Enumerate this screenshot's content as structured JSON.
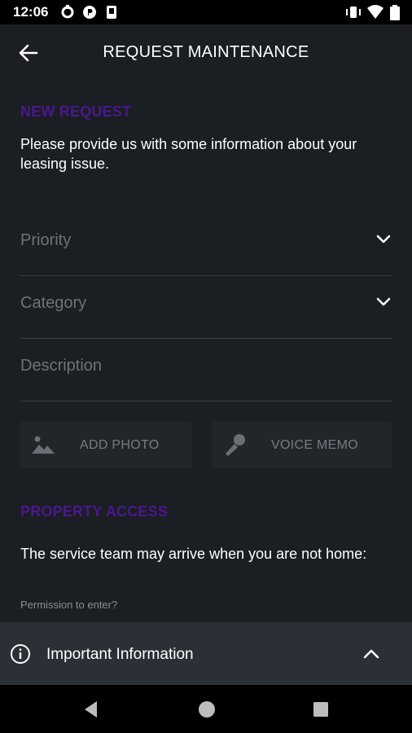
{
  "status_bar": {
    "time": "12:06"
  },
  "app_bar": {
    "title": "REQUEST MAINTENANCE"
  },
  "new_request": {
    "heading": "NEW REQUEST",
    "intro": "Please provide us with some information about your leasing issue."
  },
  "form": {
    "priority_label": "Priority",
    "category_label": "Category",
    "description_label": "Description"
  },
  "media": {
    "add_photo_label": "ADD PHOTO",
    "voice_memo_label": "VOICE MEMO"
  },
  "property_access": {
    "heading": "PROPERTY ACCESS",
    "text": "The service team may arrive when you are not home:",
    "permission_label": "Permission to enter?"
  },
  "info_panel": {
    "label": "Important Information"
  },
  "colors": {
    "background": "#1b1e22",
    "accent_purple": "#4a1790",
    "panel": "#2b3036",
    "muted_text": "#6e737a"
  },
  "icons": [
    "back-arrow-icon",
    "chevron-down-icon",
    "image-icon",
    "microphone-icon",
    "info-icon",
    "chevron-up-icon"
  ]
}
